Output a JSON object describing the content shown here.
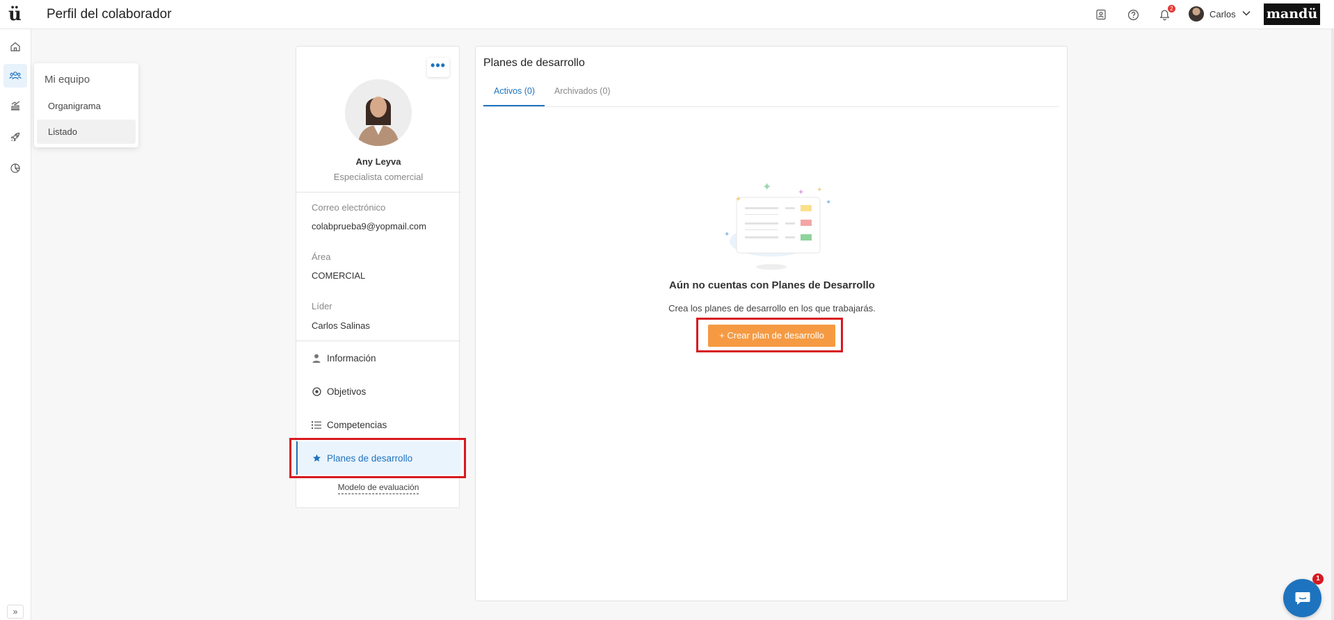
{
  "header": {
    "logo": "ü",
    "title": "Perfil del colaborador",
    "notification_count": "2",
    "user_name": "Carlos",
    "brand": "mandü"
  },
  "rail": {
    "icons": [
      "home-icon",
      "team-icon",
      "chart-icon",
      "rocket-icon",
      "pie-chart-icon"
    ],
    "expand_label": "»"
  },
  "flyout": {
    "title": "Mi equipo",
    "items": [
      "Organigrama",
      "Listado"
    ]
  },
  "profile": {
    "name": "Any Leyva",
    "role": "Especialista comercial",
    "more_label": "•••",
    "fields": [
      {
        "label": "Correo electrónico",
        "value": "colabprueba9@yopmail.com"
      },
      {
        "label": "Área",
        "value": "COMERCIAL"
      },
      {
        "label": "Líder",
        "value": "Carlos Salinas"
      }
    ],
    "nav": [
      {
        "label": "Información",
        "icon": "person-icon"
      },
      {
        "label": "Objetivos",
        "icon": "target-icon"
      },
      {
        "label": "Competencias",
        "icon": "list-icon"
      },
      {
        "label": "Planes de desarrollo",
        "icon": "star-icon"
      }
    ],
    "eval_link": "Modelo de evaluación"
  },
  "main": {
    "title": "Planes de desarrollo",
    "tabs": [
      "Activos (0)",
      "Archivados (0)"
    ],
    "empty_title": "Aún no cuentas con Planes de Desarrollo",
    "empty_subtitle": "Crea los planes de desarrollo en los que trabajarás.",
    "create_button": "+ Crear plan de desarrollo"
  },
  "chat": {
    "badge": "1"
  },
  "colors": {
    "accent": "#1e73be",
    "orange": "#f59a42",
    "highlight": "#d71920"
  }
}
